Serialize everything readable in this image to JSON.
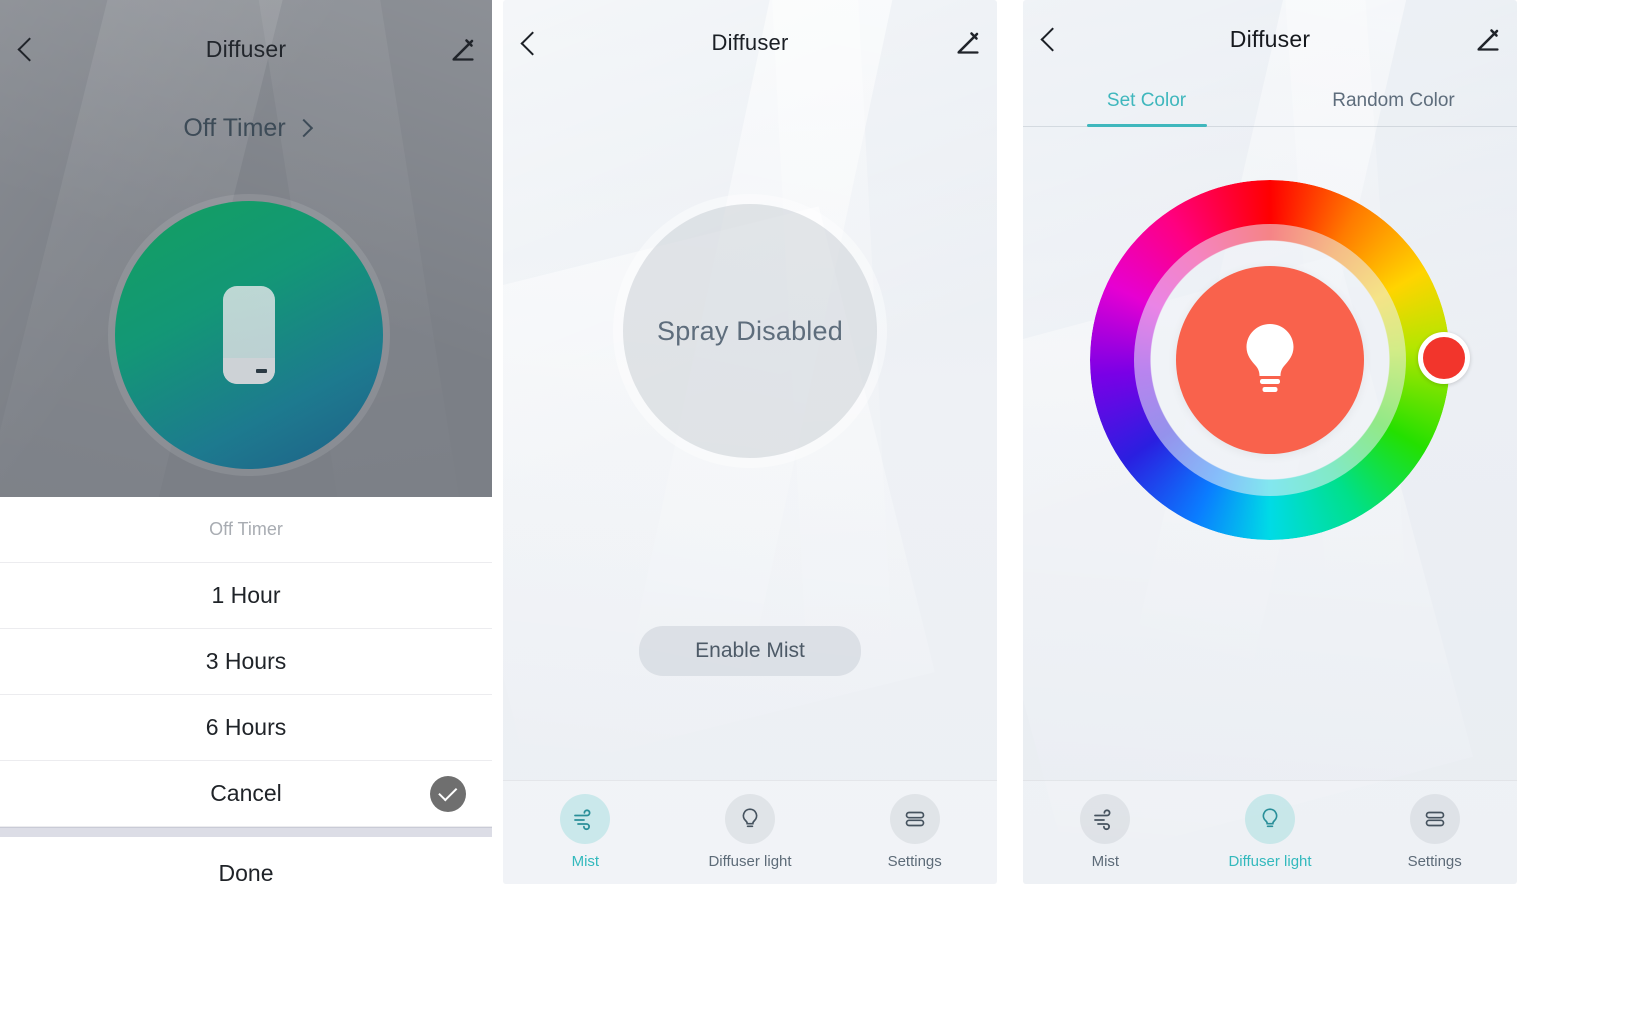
{
  "app": {
    "accent_teal": "#3fb7bd",
    "accent_red": "#f9624c",
    "title": "Diffuser"
  },
  "panel1": {
    "nav": {
      "back_icon": "chevron-left-icon",
      "title": "Diffuser",
      "edit_icon": "pencil-icon"
    },
    "off_timer_link": "Off Timer",
    "power_icon": "switch-icon",
    "sheet": {
      "header": "Off Timer",
      "options": [
        {
          "label": "1 Hour",
          "selected": false
        },
        {
          "label": "3 Hours",
          "selected": false
        },
        {
          "label": "6 Hours",
          "selected": false
        },
        {
          "label": "Cancel",
          "selected": true
        }
      ],
      "confirm_icon": "check-icon",
      "done_label": "Done"
    }
  },
  "panel2": {
    "nav": {
      "back_icon": "chevron-left-icon",
      "title": "Diffuser",
      "edit_icon": "pencil-icon"
    },
    "status_label": "Spray Disabled",
    "enable_button": "Enable Mist",
    "tabbar": [
      {
        "label": "Mist",
        "icon": "wind-icon",
        "active": true
      },
      {
        "label": "Diffuser light",
        "icon": "bulb-icon",
        "active": false
      },
      {
        "label": "Settings",
        "icon": "sliders-icon",
        "active": false
      }
    ]
  },
  "panel3": {
    "nav": {
      "back_icon": "chevron-left-icon",
      "title": "Diffuser",
      "edit_icon": "pencil-icon"
    },
    "tabs": [
      {
        "label": "Set Color",
        "active": true
      },
      {
        "label": "Random Color",
        "active": false
      }
    ],
    "color_wheel": {
      "center_icon": "bulb-icon",
      "selected_color": "#f9624c",
      "handle_color": "#f2352c"
    },
    "tabbar": [
      {
        "label": "Mist",
        "icon": "wind-icon",
        "active": false
      },
      {
        "label": "Diffuser light",
        "icon": "bulb-icon",
        "active": true
      },
      {
        "label": "Settings",
        "icon": "sliders-icon",
        "active": false
      }
    ]
  }
}
